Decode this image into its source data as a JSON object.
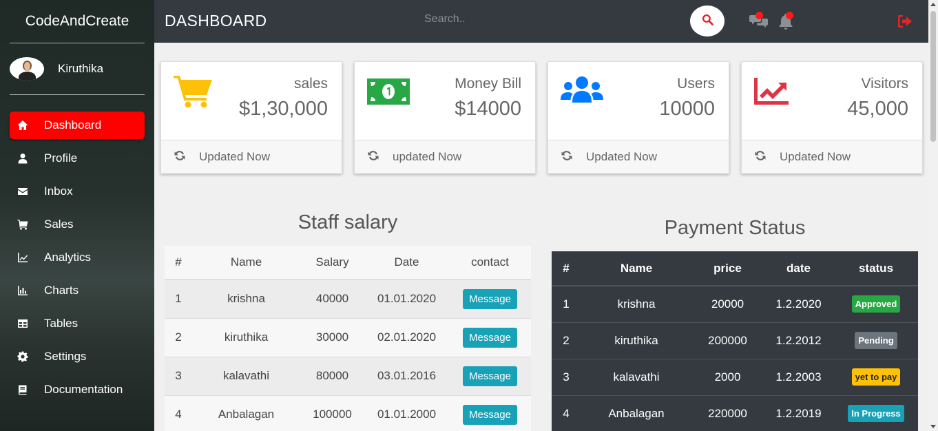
{
  "brand": "CodeAndCreate",
  "user": {
    "name": "Kiruthika"
  },
  "nav": [
    {
      "label": "Dashboard",
      "icon": "home-icon",
      "active": true
    },
    {
      "label": "Profile",
      "icon": "user-icon"
    },
    {
      "label": "Inbox",
      "icon": "envelope-icon"
    },
    {
      "label": "Sales",
      "icon": "cart-icon"
    },
    {
      "label": "Analytics",
      "icon": "line-chart-icon"
    },
    {
      "label": "Charts",
      "icon": "bar-chart-icon"
    },
    {
      "label": "Tables",
      "icon": "table-icon"
    },
    {
      "label": "Settings",
      "icon": "gear-icon"
    },
    {
      "label": "Documentation",
      "icon": "book-icon"
    }
  ],
  "topbar": {
    "title": "DASHBOARD",
    "search_placeholder": "Search.."
  },
  "cards": [
    {
      "label": "sales",
      "value": "$1,30,000",
      "footer": "Updated Now",
      "icon": "cart-icon",
      "color": "#ffc107"
    },
    {
      "label": "Money Bill",
      "value": "$14000",
      "footer": "updated Now",
      "icon": "money-bill-icon",
      "color": "#28a745"
    },
    {
      "label": "Users",
      "value": "10000",
      "footer": "Updated Now",
      "icon": "users-icon",
      "color": "#007bff"
    },
    {
      "label": "Visitors",
      "value": "45,000",
      "footer": "Updated Now",
      "icon": "chart-line-icon",
      "color": "#dc3545"
    }
  ],
  "staff": {
    "title": "Staff salary",
    "headers": [
      "#",
      "Name",
      "Salary",
      "Date",
      "contact"
    ],
    "button_label": "Message",
    "rows": [
      [
        "1",
        "krishna",
        "40000",
        "01.01.2020"
      ],
      [
        "2",
        "kiruthika",
        "30000",
        "02.01.2020"
      ],
      [
        "3",
        "kalavathi",
        "80000",
        "03.01.2016"
      ],
      [
        "4",
        "Anbalagan",
        "100000",
        "01.01.2000"
      ]
    ]
  },
  "payment": {
    "title": "Payment Status",
    "headers": [
      "#",
      "Name",
      "price",
      "date",
      "status"
    ],
    "rows": [
      {
        "cells": [
          "1",
          "krishna",
          "20000",
          "1.2.2020"
        ],
        "status": "Approved",
        "color": "#28a745",
        "text": "#ffffff"
      },
      {
        "cells": [
          "2",
          "kiruthika",
          "200000",
          "1.2.2012"
        ],
        "status": "Pending",
        "color": "#6c757d",
        "text": "#ffffff"
      },
      {
        "cells": [
          "3",
          "kalavathi",
          "2000",
          "1.2.2003"
        ],
        "status": "yet to pay",
        "color": "#ffc107",
        "text": "#212529"
      },
      {
        "cells": [
          "4",
          "Anbalagan",
          "220000",
          "1.2.2019"
        ],
        "status": "In Progress",
        "color": "#17a2b8",
        "text": "#ffffff"
      }
    ]
  }
}
